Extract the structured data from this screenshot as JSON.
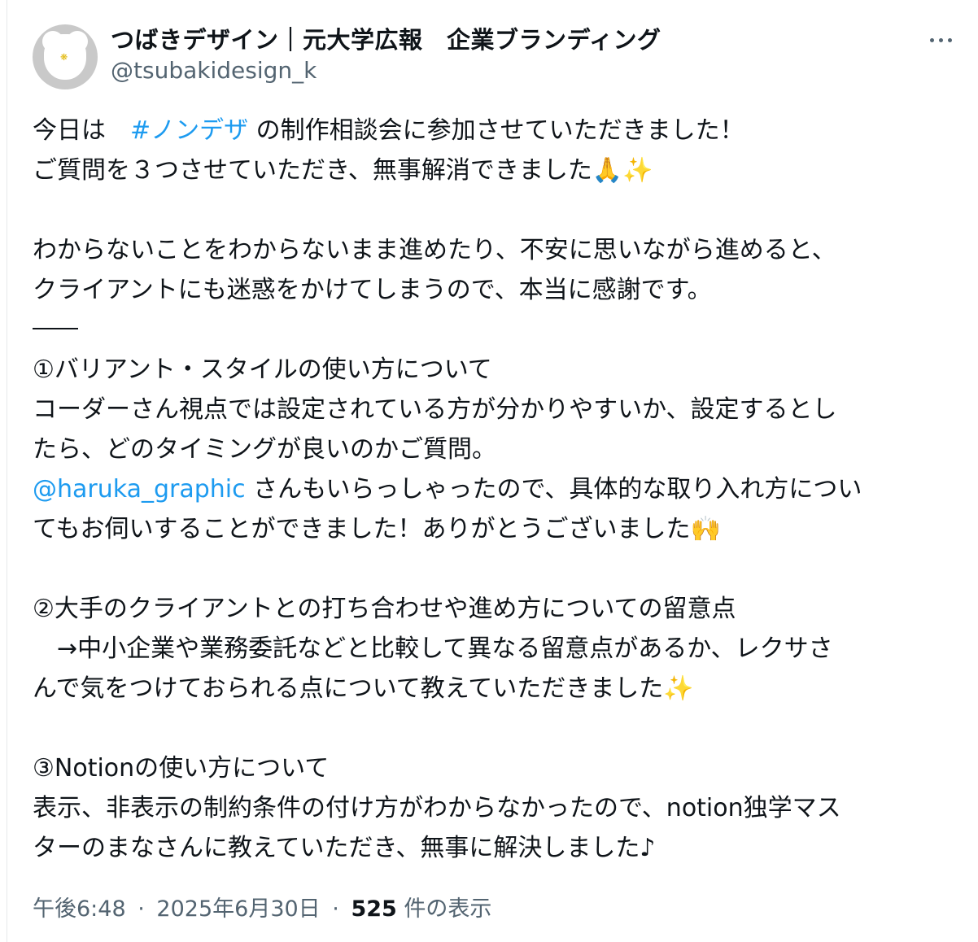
{
  "author": {
    "display_name": "つばきデザイン｜元大学広報　企業ブランディング",
    "handle": "@tsubakidesign_k",
    "avatar_icon": "camellia-logo-icon"
  },
  "more_icon": "more-horizontal-icon",
  "body": {
    "line1_prefix": "今日は　",
    "hashtag": "#ノンデザ",
    "line1_suffix": " の制作相談会に参加させていただきました！",
    "line2": "ご質問を３つさせていただき、無事解消できました🙏✨",
    "line3": "わからないことをわからないまま進めたり、不安に思いながら進めると、",
    "line4": "クライアントにも迷惑をかけてしまうので、本当に感謝です。",
    "section1_title": "①バリアント・スタイルの使い方について",
    "section1_line1": "コーダーさん視点では設定されている方が分かりやすいか、設定するとし",
    "section1_line2": "たら、どのタイミングが良いのかご質問。",
    "mention": "@haruka_graphic",
    "mention_suffix": " さんもいらっしゃったので、具体的な取り入れ方につい",
    "section1_line4": "てもお伺いすることができました！ありがとうございました🙌",
    "section2_title": "②大手のクライアントとの打ち合わせや進め方についての留意点",
    "section2_line1": "　→中小企業や業務委託などと比較して異なる留意点があるか、レクサさ",
    "section2_line2": "んで気をつけておられる点について教えていただきました✨",
    "section3_title": "③Notionの使い方について",
    "section3_line1": "表示、非表示の制約条件の付け方がわからなかったので、notion独学マス",
    "section3_line2": "ターのまなさんに教えていただき、無事に解決しました♪"
  },
  "meta": {
    "time": "午後6:48",
    "dot1": "·",
    "date": "2025年6月30日",
    "dot2": "·",
    "views_count": "525",
    "views_label": "件の表示"
  }
}
